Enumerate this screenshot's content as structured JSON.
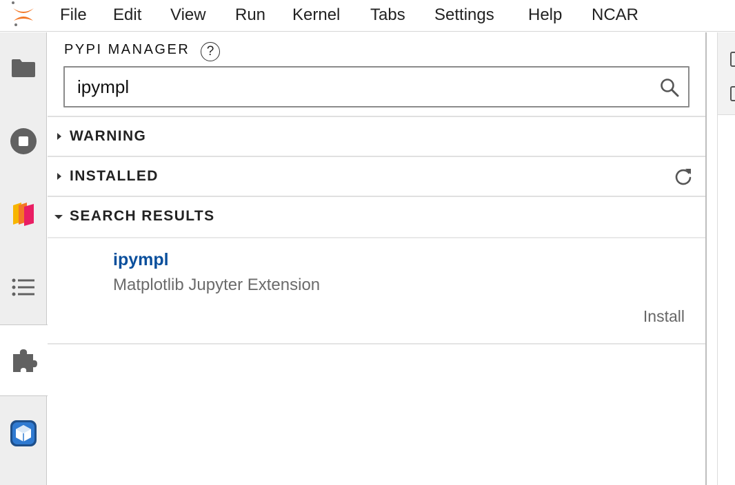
{
  "menu": {
    "items": [
      "File",
      "Edit",
      "View",
      "Run",
      "Kernel",
      "Tabs",
      "Settings",
      "Help",
      "NCAR"
    ]
  },
  "sidebar": {
    "icons": [
      "folder-icon",
      "stop-circle-icon",
      "pages-icon",
      "list-icon",
      "puzzle-icon",
      "cube-icon"
    ],
    "active": "puzzle-icon"
  },
  "panel": {
    "title": "PYPI MANAGER",
    "help_symbol": "?",
    "search": {
      "value": "ipympl"
    },
    "sections": {
      "warning": "WARNING",
      "installed": "INSTALLED",
      "search_results": "SEARCH RESULTS"
    },
    "results": [
      {
        "name": "ipympl",
        "description": "Matplotlib Jupyter Extension",
        "action": "Install"
      }
    ]
  },
  "colors": {
    "accent_link": "#0a4f9c",
    "jupyter_orange": "#f37726"
  }
}
